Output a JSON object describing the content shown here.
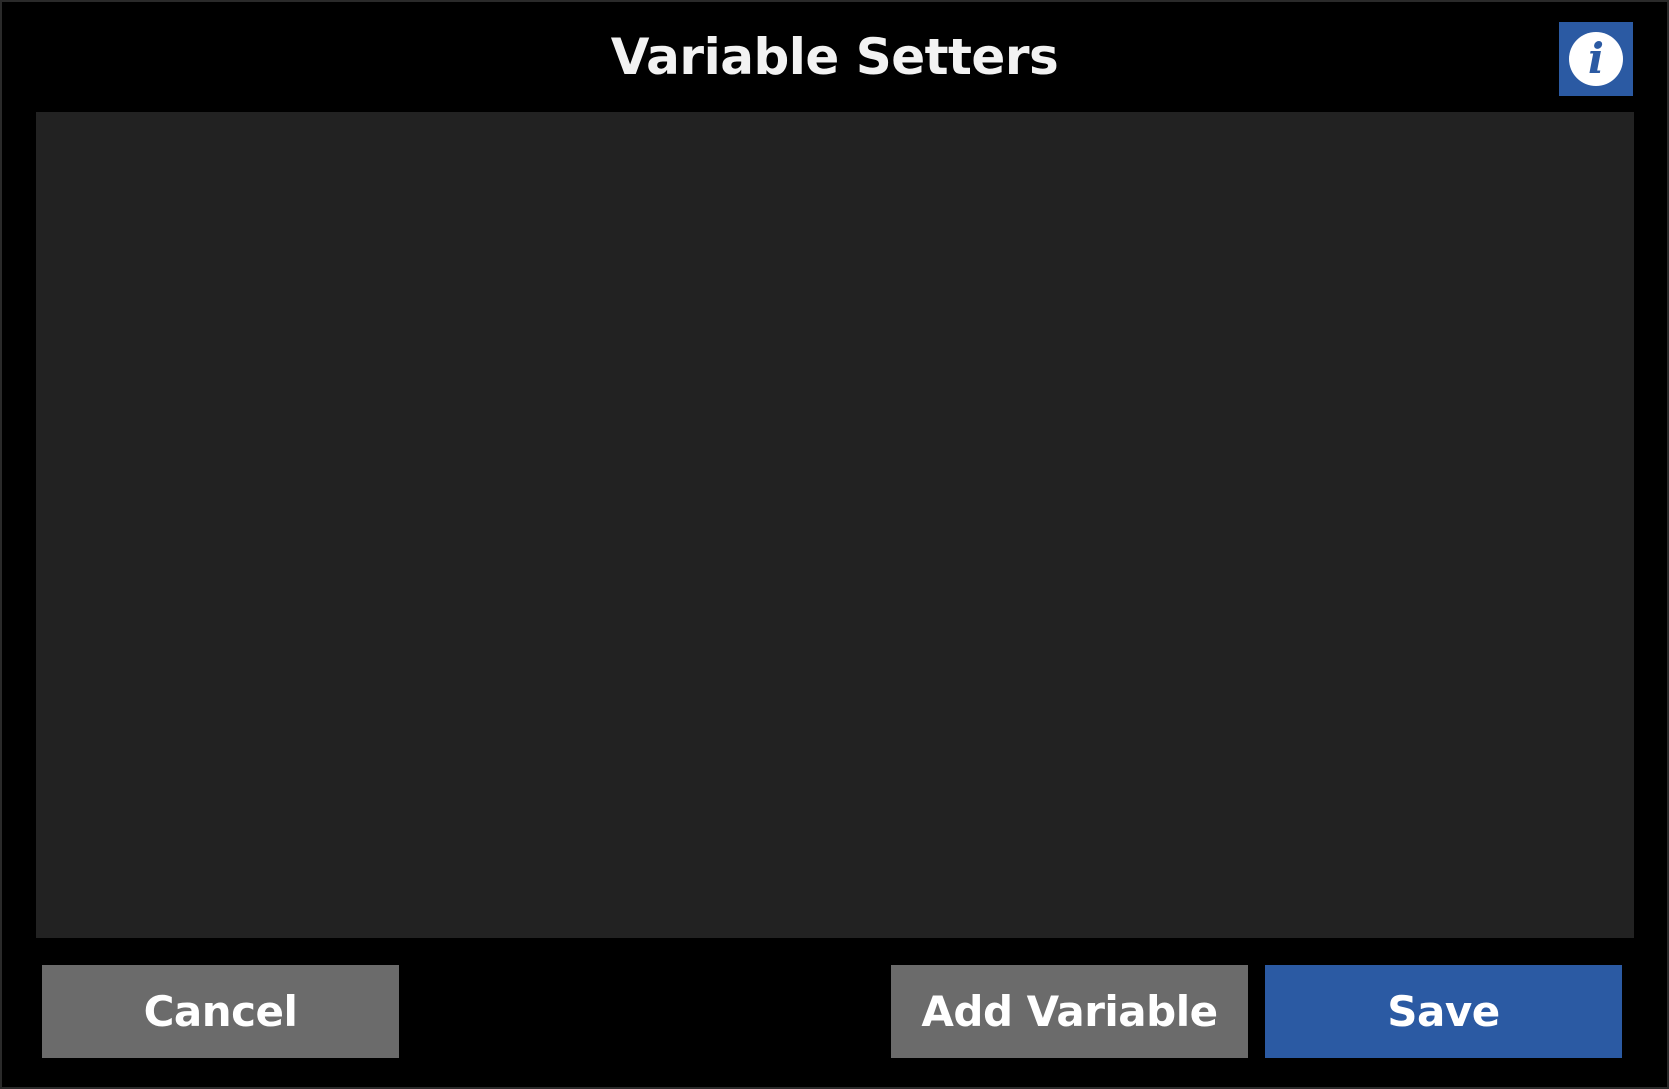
{
  "dialog": {
    "title": "Variable Setters",
    "info_icon": "info-icon",
    "info_glyph": "i"
  },
  "buttons": {
    "cancel_label": "Cancel",
    "add_variable_label": "Add Variable",
    "save_label": "Save"
  },
  "colors": {
    "accent": "#2b5aa3",
    "secondary_button": "#6b6b6b",
    "panel": "#222222",
    "background": "#000000"
  }
}
